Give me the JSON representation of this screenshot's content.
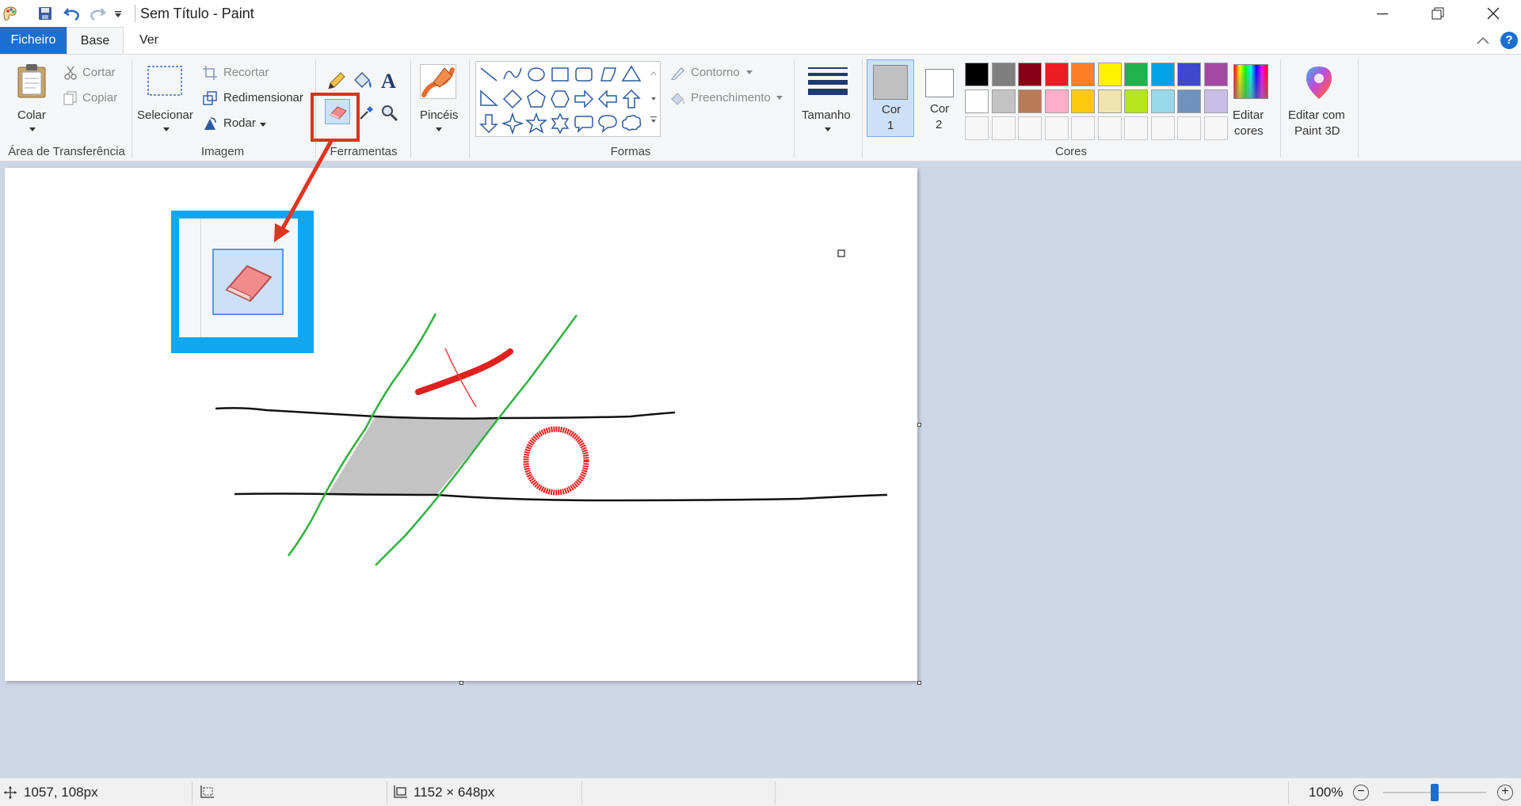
{
  "window": {
    "title": "Sem Título - Paint"
  },
  "tabs": {
    "file": "Ficheiro",
    "home": "Base",
    "view": "Ver"
  },
  "clipboard": {
    "paste": "Colar",
    "cut": "Cortar",
    "copy": "Copiar",
    "group": "Área de Transferência"
  },
  "image": {
    "select": "Selecionar",
    "crop": "Recortar",
    "resize": "Redimensionar",
    "rotate": "Rodar",
    "group": "Imagem"
  },
  "tools": {
    "group": "Ferramentas",
    "selected": "eraser"
  },
  "brushes": {
    "label": "Pincéis"
  },
  "shapes": {
    "outline": "Contorno",
    "fill": "Preenchimento",
    "group": "Formas"
  },
  "size": {
    "label": "Tamanho"
  },
  "colors": {
    "color1_l1": "Cor",
    "color1_l2": "1",
    "color2_l1": "Cor",
    "color2_l2": "2",
    "group": "Cores",
    "edit_l1": "Editar",
    "edit_l2": "cores",
    "color1_value": "#c0c0c0",
    "color2_value": "#ffffff",
    "palette_row1": [
      "#000000",
      "#7f7f7f",
      "#880015",
      "#ed1c24",
      "#ff7f27",
      "#fff200",
      "#22b14c",
      "#00a2e8",
      "#3f48cc",
      "#a349a4"
    ],
    "palette_row2": [
      "#ffffff",
      "#c3c3c3",
      "#b97a57",
      "#ffaec9",
      "#ffc90e",
      "#efe4b0",
      "#b5e61d",
      "#99d9ea",
      "#7092be",
      "#c8bfe7"
    ]
  },
  "paint3d": {
    "l1": "Editar com",
    "l2": "Paint 3D"
  },
  "status": {
    "cursor": "1057, 108px",
    "canvas_size": "1152 × 648px",
    "zoom": "100%"
  }
}
